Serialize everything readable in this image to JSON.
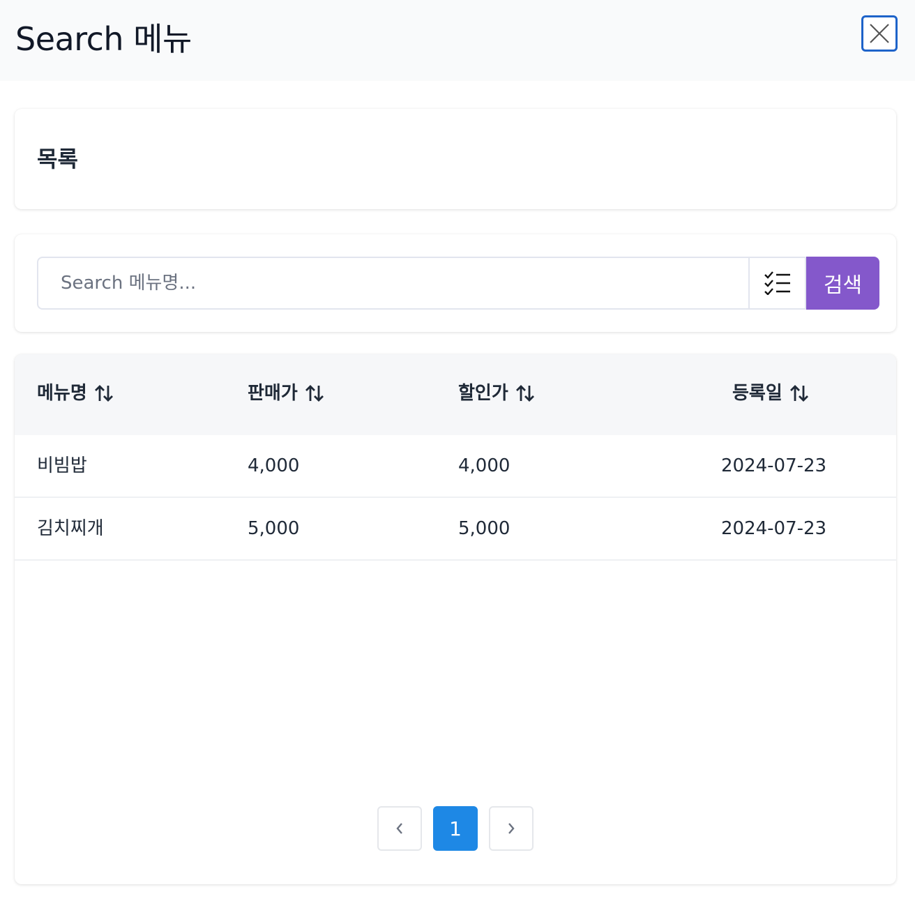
{
  "header": {
    "title": "Search 메뉴",
    "close_icon": "close-icon"
  },
  "list_card": {
    "heading": "목록"
  },
  "search": {
    "placeholder": "Search 메뉴명...",
    "filter_icon": "checklist-icon",
    "button_label": "검색",
    "button_color": "#8458cb"
  },
  "table": {
    "columns": [
      {
        "label": "메뉴명",
        "sort_icon": "sort-icon"
      },
      {
        "label": "판매가",
        "sort_icon": "sort-icon"
      },
      {
        "label": "할인가",
        "sort_icon": "sort-icon"
      },
      {
        "label": "등록일",
        "sort_icon": "sort-icon"
      }
    ],
    "rows": [
      {
        "name": "비빔밥",
        "price": "4,000",
        "discount": "4,000",
        "date": "2024-07-23"
      },
      {
        "name": "김치찌개",
        "price": "5,000",
        "discount": "5,000",
        "date": "2024-07-23"
      }
    ]
  },
  "pagination": {
    "prev_icon": "chevron-left-icon",
    "current_page": "1",
    "next_icon": "chevron-right-icon",
    "active_color": "#1e88e5"
  }
}
